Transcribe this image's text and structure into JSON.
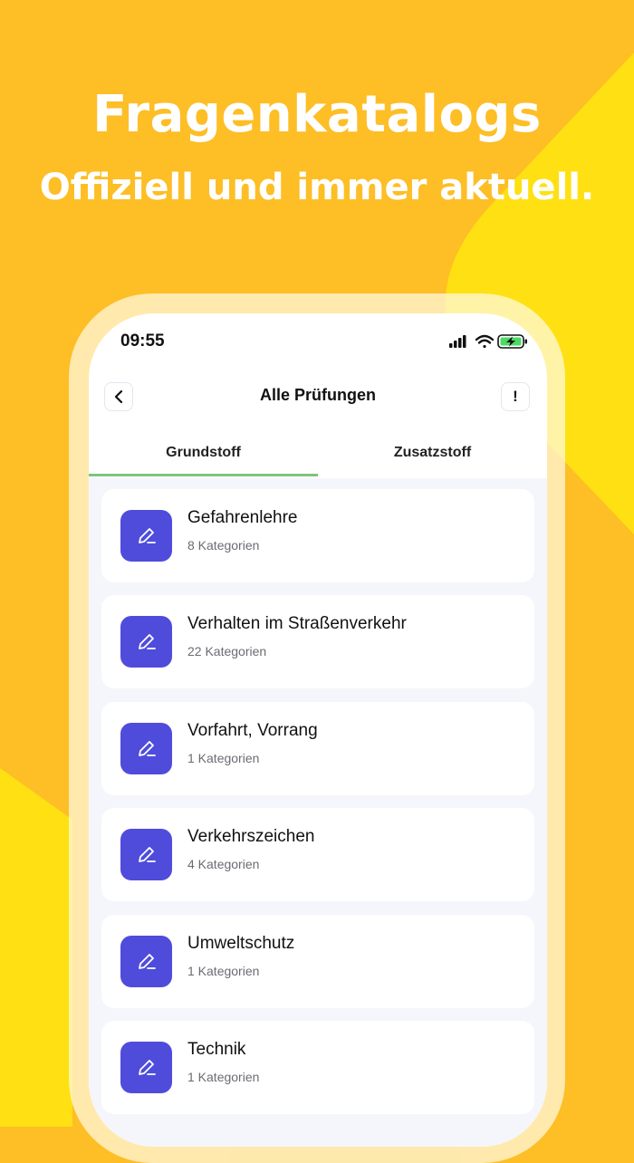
{
  "promo": {
    "title": "Fragenkatalogs",
    "subtitle": "Offiziell und immer aktuell."
  },
  "colors": {
    "background": "#FDBE26",
    "accent_yellow": "#FFE012",
    "icon_tile": "#4f4cdc",
    "tab_underline": "#7cc47f"
  },
  "status_bar": {
    "time": "09:55",
    "icons": [
      "signal-icon",
      "wifi-icon",
      "battery-charging-icon"
    ]
  },
  "nav": {
    "title": "Alle Prüfungen",
    "back_icon": "chevron-left-icon",
    "info_label": "!"
  },
  "tabs": [
    {
      "label": "Grundstoff",
      "active": true
    },
    {
      "label": "Zusatzstoff",
      "active": false
    }
  ],
  "categories": [
    {
      "title": "Gefahrenlehre",
      "subtitle": "8 Kategorien",
      "icon": "pencil-icon"
    },
    {
      "title": "Verhalten im Straßenverkehr",
      "subtitle": "22 Kategorien",
      "icon": "pencil-icon"
    },
    {
      "title": "Vorfahrt, Vorrang",
      "subtitle": "1 Kategorien",
      "icon": "pencil-icon"
    },
    {
      "title": "Verkehrszeichen",
      "subtitle": "4 Kategorien",
      "icon": "pencil-icon"
    },
    {
      "title": "Umweltschutz",
      "subtitle": "1 Kategorien",
      "icon": "pencil-icon"
    },
    {
      "title": "Technik",
      "subtitle": "1 Kategorien",
      "icon": "pencil-icon"
    }
  ]
}
